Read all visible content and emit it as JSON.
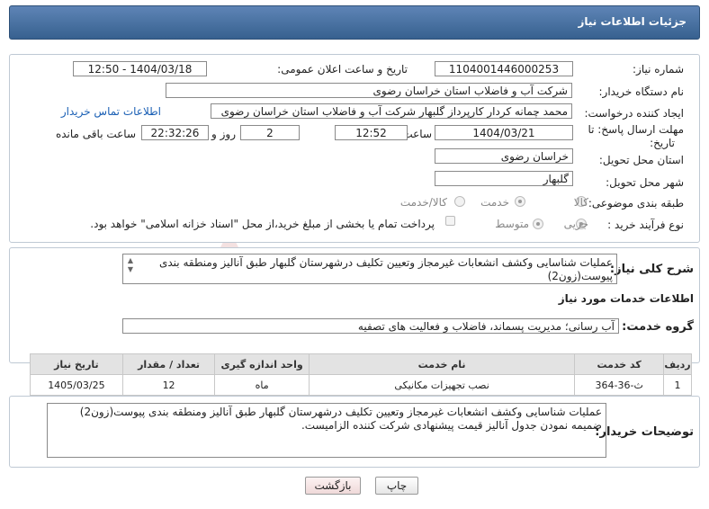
{
  "header": {
    "title": "جزئیات اطلاعات نیاز"
  },
  "form": {
    "need_number_label": "شماره نیاز:",
    "need_number": "1104001446000253",
    "announce_label": "تاریخ و ساعت اعلان عمومی:",
    "announce_value": "1404/03/18 - 12:50",
    "buyer_org_label": "نام دستگاه خریدار:",
    "buyer_org": "شرکت آب و فاضلاب استان خراسان رضوی",
    "requester_label": "ایجاد کننده درخواست:",
    "requester": "محمد چمانه کردار کارپرداز گلبهار  شرکت آب و فاضلاب استان خراسان رضوی",
    "contact_link": "اطلاعات تماس خریدار",
    "deadline_label_1": "مهلت ارسال پاسخ: تا",
    "deadline_label_2": "تاریخ:",
    "deadline_date": "1404/03/21",
    "time_label": "ساعت",
    "deadline_time": "12:52",
    "days_value": "2",
    "days_label": "روز و",
    "remaining_time": "22:32:26",
    "remaining_label": "ساعت باقی مانده",
    "province_label": "استان محل تحویل:",
    "province": "خراسان رضوی",
    "city_label": "شهر محل تحویل:",
    "city": "گلبهار",
    "category_label": "طبقه بندی موضوعی:",
    "category_options": [
      "کالا",
      "خدمت",
      "کالا/خدمت"
    ],
    "category_selected": "خدمت",
    "process_label": "نوع فرآیند خرید :",
    "process_options": [
      "جزیی",
      "متوسط"
    ],
    "process_selected": "جزیی",
    "payment_note": "پرداخت تمام یا بخشی از مبلغ خرید،از محل \"اسناد خزانه اسلامی\" خواهد بود."
  },
  "summary": {
    "label": "شرح کلی نیاز:",
    "text": "عملیات شناسایی وکشف انشعابات غیرمجاز وتعیین تکلیف درشهرستان گلبهار طبق آنالیز ومنطقه بندی پیوست(زون2)"
  },
  "services": {
    "section_title": "اطلاعات خدمات مورد نیاز",
    "group_label": "گروه خدمت:",
    "group_value": "آب رسانی؛ مدیریت پسماند، فاضلاب و فعالیت های تصفیه",
    "columns": [
      "ردیف",
      "کد خدمت",
      "نام خدمت",
      "واحد اندازه گیری",
      "تعداد / مقدار",
      "تاریخ نیاز"
    ],
    "rows": [
      [
        "1",
        "ث-36-364",
        "نصب تجهیزات مکانیکی",
        "ماه",
        "12",
        "1405/03/25"
      ]
    ]
  },
  "buyer_notes": {
    "label": "توضیحات خریدار:",
    "text": "عملیات شناسایی وکشف انشعابات غیرمجاز وتعیین تکلیف درشهرستان گلبهار طبق آنالیز ومنطقه بندی پیوست(زون2) ضمیمه نمودن جدول آنالیز قیمت پیشنهادی شرکت کننده الزامیست."
  },
  "buttons": {
    "print": "چاپ",
    "back": "بازگشت"
  },
  "watermark": {
    "text": "AriaTender.net"
  },
  "colors": {
    "header": "#4a72a3",
    "link": "#1a5fb4",
    "back_button": "#f7e7e7"
  }
}
